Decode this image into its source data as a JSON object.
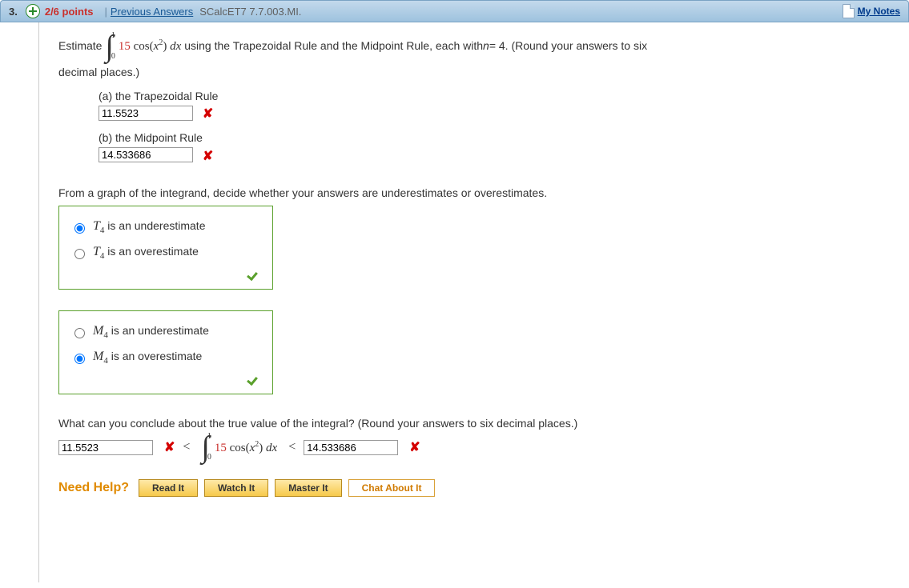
{
  "header": {
    "question_number": "3.",
    "points": "2/6 points",
    "divider": "|",
    "previous_answers": "Previous Answers",
    "problem_id": "SCalcET7 7.7.003.MI.",
    "my_notes": "My Notes"
  },
  "prompt": {
    "estimate": "Estimate",
    "upper": "1",
    "lower": "0",
    "coef": "15",
    "func": "cos(",
    "var": "x",
    "exp": "2",
    "close": ")",
    "dx": "dx",
    "tail1": "using the Trapezoidal Rule and the Midpoint Rule, each with ",
    "nvar": "n",
    "neq": " = 4. (Round your answers to six",
    "tail2": "decimal places.)"
  },
  "parts": {
    "a": {
      "label": "(a) the Trapezoidal Rule",
      "value": "11.5523"
    },
    "b": {
      "label": "(b) the Midpoint Rule",
      "value": "14.533686"
    }
  },
  "section2": {
    "prompt": "From a graph of the integrand, decide whether your answers are underestimates or overestimates.",
    "t4_under": " is an underestimate",
    "t4_over": " is an overestimate",
    "m4_under": " is an underestimate",
    "m4_over": " is an overestimate",
    "t_sym": "T",
    "m_sym": "M",
    "sub": "4"
  },
  "section3": {
    "prompt": "What can you conclude about the true value of the integral? (Round your answers to six decimal places.)",
    "lower_value": "11.5523",
    "upper_value": "14.533686",
    "lt": "<"
  },
  "help": {
    "label": "Need Help?",
    "read": "Read It",
    "watch": "Watch It",
    "master": "Master It",
    "chat": "Chat About It"
  }
}
